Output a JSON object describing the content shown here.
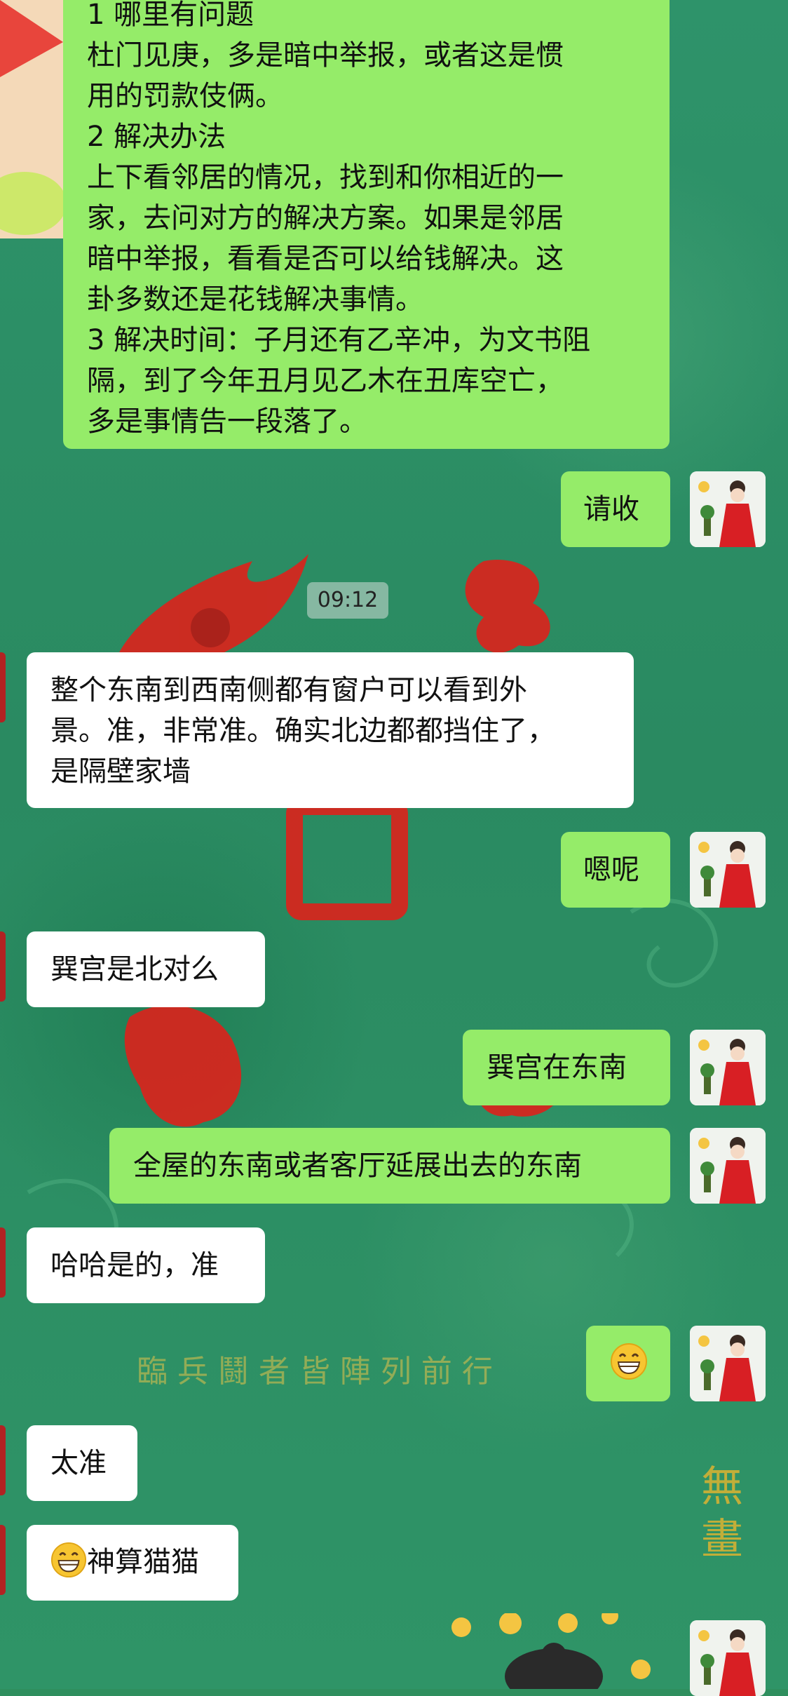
{
  "chat": {
    "time_divider": "09:12",
    "messages": [
      {
        "side": "out",
        "lines": [
          "1 哪里有问题",
          "杜门见庚，多是暗中举报，或者这是惯",
          "用的罚款伎俩。",
          "2 解决办法",
          "上下看邻居的情况，找到和你相近的一",
          "家，去问对方的解决方案。如果是邻居",
          "暗中举报，看看是否可以给钱解决。这",
          "卦多数还是花钱解决事情。",
          "3 解决时间：子月还有乙辛冲，为文书阻",
          "隔，到了今年丑月见乙木在丑库空亡，",
          "多是事情告一段落了。"
        ]
      },
      {
        "side": "out",
        "text": "请收"
      },
      {
        "side": "in",
        "lines": [
          "整个东南到西南侧都有窗户可以看到外",
          "景。准，非常准。确实北边都都挡住了，",
          "是隔壁家墙"
        ]
      },
      {
        "side": "out",
        "text": "嗯呢"
      },
      {
        "side": "in",
        "text": "巽宫是北对么"
      },
      {
        "side": "out",
        "text": "巽宫在东南"
      },
      {
        "side": "out",
        "text": "全屋的东南或者客厅延展出去的东南"
      },
      {
        "side": "in",
        "text": "哈哈是的，准"
      },
      {
        "side": "out",
        "emoji": "grin-emoji"
      },
      {
        "side": "in",
        "text": "太准"
      },
      {
        "side": "in",
        "text": "神算猫猫",
        "emoji": "grin-emoji"
      }
    ]
  },
  "colors": {
    "outgoing_bubble": "#95ec69",
    "incoming_bubble": "#ffffff",
    "background": "#2f8f5e",
    "decoration_red": "#d9241c"
  }
}
